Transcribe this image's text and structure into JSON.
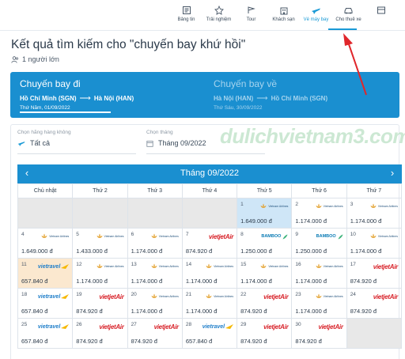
{
  "nav": {
    "items": [
      {
        "label": "Bảng tin",
        "icon": "news-icon"
      },
      {
        "label": "Trải nghiệm",
        "icon": "experience-icon"
      },
      {
        "label": "Tour",
        "icon": "tour-icon"
      },
      {
        "label": "Khách sạn",
        "icon": "hotel-icon"
      },
      {
        "label": "Vé máy bay",
        "icon": "plane-icon"
      },
      {
        "label": "Cho thuê xe",
        "icon": "car-icon"
      },
      {
        "label": "",
        "icon": "more-icon"
      }
    ],
    "active_label": "Vé máy bay",
    "accent": "#1a9ad6"
  },
  "page": {
    "title": "Kết quả tìm kiếm cho \"chuyến bay khứ hồi\"",
    "passengers": "1 người lớn"
  },
  "banner": {
    "outbound": {
      "heading": "Chuyến bay đi",
      "from": "Hồ Chí Minh (SGN)",
      "to": "Hà Nội (HAN)",
      "date": "Thứ Năm, 01/09/2022"
    },
    "return": {
      "heading": "Chuyến bay về",
      "from": "Hà Nội (HAN)",
      "to": "Hồ Chí Minh (SGN)",
      "date": "Thứ Sáu, 30/09/2022"
    },
    "arrow": "⟶",
    "color": "#1a8fd0"
  },
  "filters": {
    "airline": {
      "caption": "Chọn hãng hàng không",
      "value": "Tất cả"
    },
    "month": {
      "caption": "Chọn tháng",
      "value": "Tháng 09/2022"
    }
  },
  "watermark": "dulichvietnam3.com",
  "calendar": {
    "month_label": "Tháng 09/2022",
    "prev": "‹",
    "next": "›",
    "weekdays": [
      "Chủ nhật",
      "Thứ 2",
      "Thứ 3",
      "Thứ 4",
      "Thứ 5",
      "Thứ 6",
      "Thứ 7"
    ],
    "weeks": [
      [
        {
          "empty": true
        },
        {
          "empty": true
        },
        {
          "empty": true
        },
        {
          "empty": true
        },
        {
          "day": "1",
          "price": "1.649.000 đ",
          "airline": "vietnam-airlines",
          "state": "selected"
        },
        {
          "day": "2",
          "price": "1.174.000 đ",
          "airline": "vietnam-airlines"
        },
        {
          "day": "3",
          "price": "1.174.000 đ",
          "airline": "vietnam-airlines"
        }
      ],
      [
        {
          "day": "4",
          "price": "1.649.000 đ",
          "airline": "vietnam-airlines"
        },
        {
          "day": "5",
          "price": "1.433.000 đ",
          "airline": "vietnam-airlines"
        },
        {
          "day": "6",
          "price": "1.174.000 đ",
          "airline": "vietnam-airlines"
        },
        {
          "day": "7",
          "price": "874.920 đ",
          "airline": "vietjet"
        },
        {
          "day": "8",
          "price": "1.250.000 đ",
          "airline": "bamboo"
        },
        {
          "day": "9",
          "price": "1.250.000 đ",
          "airline": "bamboo"
        },
        {
          "day": "10",
          "price": "1.174.000 đ",
          "airline": "vietnam-airlines"
        }
      ],
      [
        {
          "day": "11",
          "price": "657.840 đ",
          "airline": "vietravel",
          "state": "lowest"
        },
        {
          "day": "12",
          "price": "1.174.000 đ",
          "airline": "vietnam-airlines"
        },
        {
          "day": "13",
          "price": "1.174.000 đ",
          "airline": "vietnam-airlines"
        },
        {
          "day": "14",
          "price": "1.174.000 đ",
          "airline": "vietnam-airlines"
        },
        {
          "day": "15",
          "price": "1.174.000 đ",
          "airline": "vietnam-airlines"
        },
        {
          "day": "16",
          "price": "1.174.000 đ",
          "airline": "vietnam-airlines"
        },
        {
          "day": "17",
          "price": "874.920 đ",
          "airline": "vietjet"
        }
      ],
      [
        {
          "day": "18",
          "price": "657.840 đ",
          "airline": "vietravel"
        },
        {
          "day": "19",
          "price": "874.920 đ",
          "airline": "vietjet"
        },
        {
          "day": "20",
          "price": "1.174.000 đ",
          "airline": "vietnam-airlines"
        },
        {
          "day": "21",
          "price": "1.174.000 đ",
          "airline": "vietnam-airlines"
        },
        {
          "day": "22",
          "price": "874.920 đ",
          "airline": "vietjet"
        },
        {
          "day": "23",
          "price": "1.174.000 đ",
          "airline": "vietnam-airlines"
        },
        {
          "day": "24",
          "price": "874.920 đ",
          "airline": "vietjet"
        }
      ],
      [
        {
          "day": "25",
          "price": "657.840 đ",
          "airline": "vietravel"
        },
        {
          "day": "26",
          "price": "874.920 đ",
          "airline": "vietjet"
        },
        {
          "day": "27",
          "price": "874.920 đ",
          "airline": "vietjet"
        },
        {
          "day": "28",
          "price": "657.840 đ",
          "airline": "vietravel"
        },
        {
          "day": "29",
          "price": "874.920 đ",
          "airline": "vietjet"
        },
        {
          "day": "30",
          "price": "874.920 đ",
          "airline": "vietjet"
        },
        {
          "empty": true
        }
      ]
    ]
  },
  "airline_logos": {
    "vietnam-airlines": {
      "mark": "lotus",
      "text": "Vietnam Airlines",
      "color": "#e3a02b"
    },
    "vietjet": {
      "text": "vietjet",
      "suffix": "Air",
      "color": "#d8232a"
    },
    "bamboo": {
      "text": "BAMBOO",
      "color": "#0a7bb5"
    },
    "vietravel": {
      "text": "vietravel",
      "color": "#1d7dc9"
    }
  },
  "colors": {
    "selected_cell": "#cfe6f7",
    "lowest_cell": "#fbe8cf",
    "empty_cell": "#e8e8e8",
    "annotation_arrow": "#e0262b"
  }
}
